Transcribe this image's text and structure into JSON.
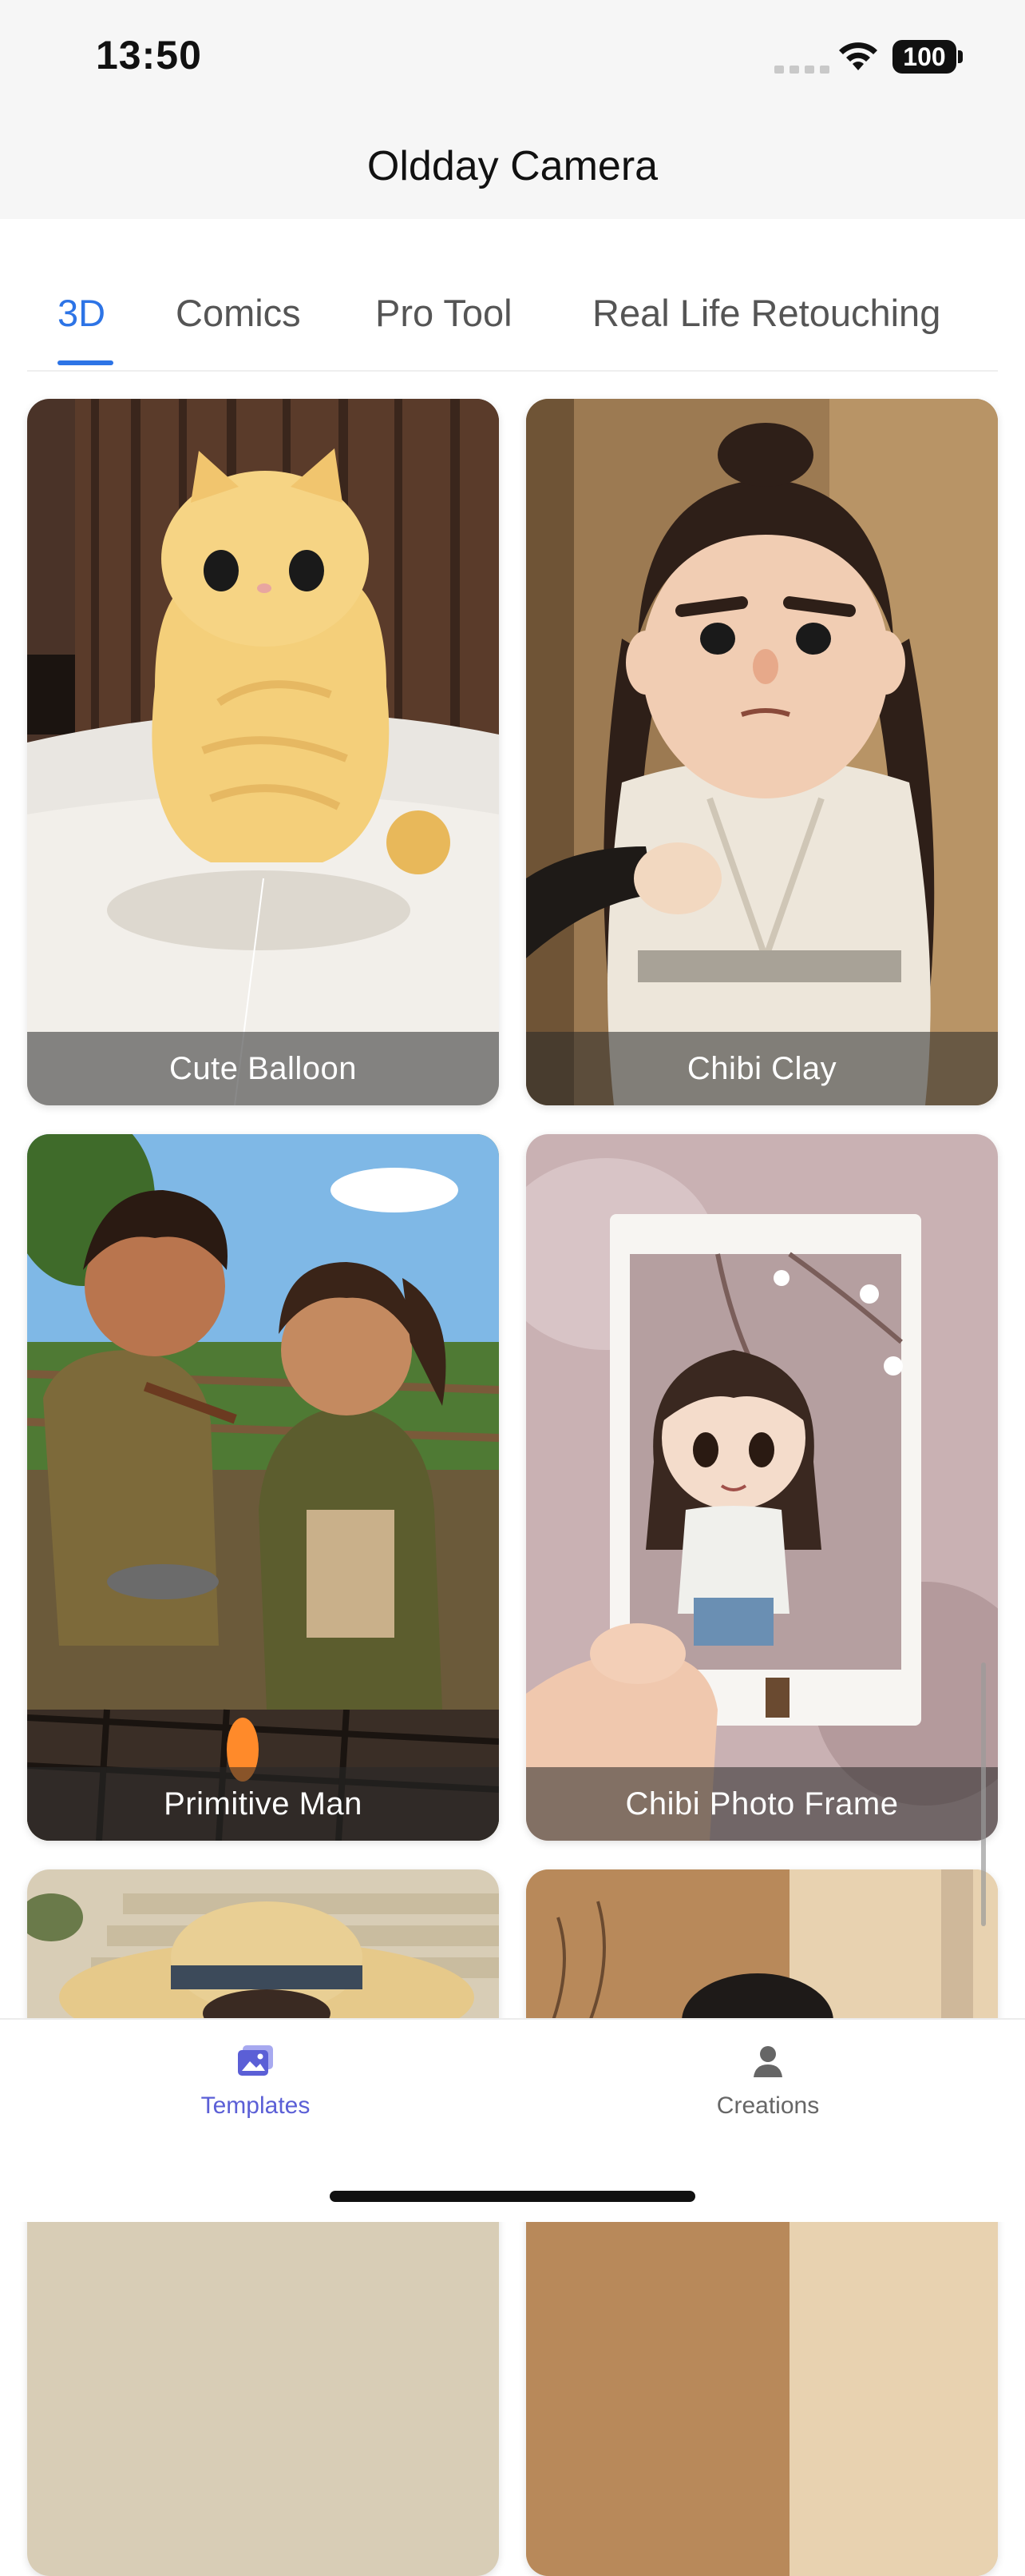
{
  "status": {
    "time": "13:50",
    "battery": "100"
  },
  "header": {
    "title": "Oldday Camera"
  },
  "tabs": [
    {
      "label": "3D",
      "active": true
    },
    {
      "label": "Comics",
      "active": false
    },
    {
      "label": "Pro Tool",
      "active": false
    },
    {
      "label": "Real Life Retouching",
      "active": false
    }
  ],
  "templates": [
    {
      "label": "Cute Balloon"
    },
    {
      "label": "Chibi Clay"
    },
    {
      "label": "Primitive Man"
    },
    {
      "label": "Chibi Photo Frame"
    }
  ],
  "bottom_nav": {
    "templates_label": "Templates",
    "creations_label": "Creations"
  },
  "colors": {
    "accent": "#2d74e6",
    "nav_active": "#5b5fd6"
  }
}
